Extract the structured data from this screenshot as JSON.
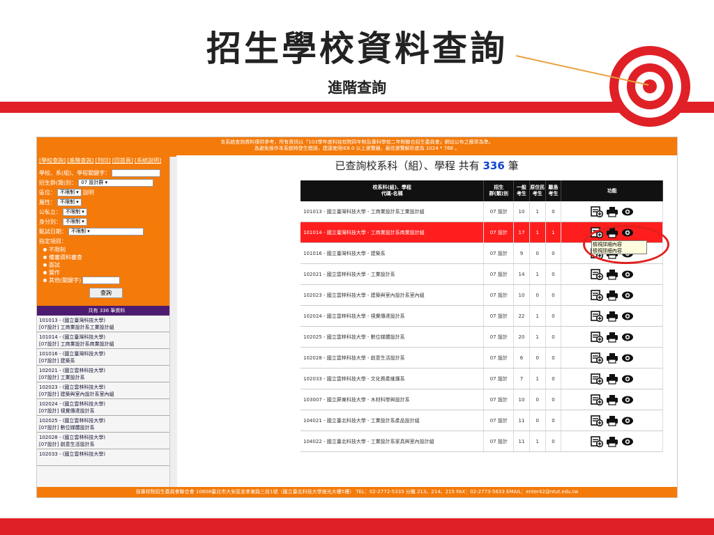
{
  "slide": {
    "title": "招生學校資料查詢",
    "subtitle": "進階查詢"
  },
  "notice": {
    "line1": "本系統查詢資料僅供參考，所有資訊以「103學年度科技校院四年制及專科學校二年制聯合招生委員會」網站公布之簡章為準。",
    "line2": "為避免操作本系統時發生錯誤，建議使用IE8.0 以上瀏覽器，最佳瀏覽解析度為 1024 * 768 。"
  },
  "sidebar": {
    "links": [
      "[學校查詢]",
      "[進階查詢]",
      "[列印]",
      "[回首頁]",
      "[系統說明]"
    ],
    "keyword_label": "學校、系(組)、學程關鍵字：",
    "group_label": "招生群(類)別：",
    "group_value": "07 設計群",
    "region_label": "區位：",
    "region_value": "不限制",
    "region_help": "說明",
    "attr_label": "屬性：",
    "attr_value": "不限制",
    "public_label": "公私立：",
    "public_value": "不限制",
    "identity_label": "身分別：",
    "identity_value": "不限制",
    "exam_date_label": "甄試日期：",
    "exam_date_value": "不限制",
    "items_label": "指定項目：",
    "options": [
      "不限制",
      "備審資料審查",
      "面試",
      "實作",
      "其他(關鍵字)"
    ],
    "search_button": "查詢",
    "count_text": "共有 336 筆資料",
    "list": [
      {
        "code": "101013 - (國立臺灣科技大學)",
        "dept": "[07設計] 工商業設計系工業設計組"
      },
      {
        "code": "101014 - (國立臺灣科技大學)",
        "dept": "[07設計] 工商業設計系商業設計組"
      },
      {
        "code": "101016 - (國立臺灣科技大學)",
        "dept": "[07設計] 建築系"
      },
      {
        "code": "102021 - (國立雲林科技大學)",
        "dept": "[07設計] 工業設計系"
      },
      {
        "code": "102023 - (國立雲林科技大學)",
        "dept": "[07設計] 建築與室內設計系室內組"
      },
      {
        "code": "102024 - (國立雲林科技大學)",
        "dept": "[07設計] 視覺傳達設計系"
      },
      {
        "code": "102025 - (國立雲林科技大學)",
        "dept": "[07設計] 數位媒體設計系"
      },
      {
        "code": "102028 - (國立雲林科技大學)",
        "dept": "[07設計] 創意生活設計系"
      },
      {
        "code": "102033 - (國立雲林科技大學)",
        "dept": ""
      }
    ]
  },
  "main": {
    "title_prefix": "已查詢校系科（組）、學程 共有",
    "count": "336",
    "title_suffix": "筆",
    "headers": {
      "name1": "校系科(組)、學程",
      "name2": "代碼-名稱",
      "group1": "招生",
      "group2": "群(類)別",
      "general1": "一般",
      "general2": "考生",
      "indigenous1": "原住民",
      "indigenous2": "考生",
      "island1": "離島",
      "island2": "考生",
      "actions": "功能"
    },
    "rows": [
      {
        "name": "101013 - 國立臺灣科技大學 - 工商業設計系工業設計組",
        "group": "07 設計",
        "general": "10",
        "indigenous": "1",
        "island": "0"
      },
      {
        "name": "101014 - 國立臺灣科技大學 - 工商業設計系商業設計組",
        "group": "07 設計",
        "general": "17",
        "indigenous": "1",
        "island": "1"
      },
      {
        "name": "101016 - 國立臺灣科技大學 - 建築系",
        "group": "07 設計",
        "general": "9",
        "indigenous": "0",
        "island": "0"
      },
      {
        "name": "102021 - 國立雲林科技大學 - 工業設計系",
        "group": "07 設計",
        "general": "14",
        "indigenous": "1",
        "island": "0"
      },
      {
        "name": "102023 - 國立雲林科技大學 - 建築與室內設計系室內組",
        "group": "07 設計",
        "general": "10",
        "indigenous": "0",
        "island": "0"
      },
      {
        "name": "102024 - 國立雲林科技大學 - 視覺傳達設計系",
        "group": "07 設計",
        "general": "22",
        "indigenous": "1",
        "island": "0"
      },
      {
        "name": "102025 - 國立雲林科技大學 - 數位媒體設計系",
        "group": "07 設計",
        "general": "20",
        "indigenous": "1",
        "island": "0"
      },
      {
        "name": "102028 - 國立雲林科技大學 - 創意生活設計系",
        "group": "07 設計",
        "general": "6",
        "indigenous": "0",
        "island": "0"
      },
      {
        "name": "102033 - 國立雲林科技大學 - 文化資產維護系",
        "group": "07 設計",
        "general": "7",
        "indigenous": "1",
        "island": "0"
      },
      {
        "name": "103007 - 國立屏東科技大學 - 木材科學與設計系",
        "group": "07 設計",
        "general": "10",
        "indigenous": "0",
        "island": "0"
      },
      {
        "name": "104021 - 國立臺北科技大學 - 工業設計系產品設計組",
        "group": "07 設計",
        "general": "11",
        "indigenous": "0",
        "island": "0"
      },
      {
        "name": "104022 - 國立臺北科技大學 - 工業設計系家具與室內設計組",
        "group": "07 設計",
        "general": "11",
        "indigenous": "1",
        "island": "0"
      }
    ],
    "tooltip": {
      "line1": "檢視詳細內容",
      "line2": "檢視詳細內容"
    }
  },
  "footer": "技專校院招生委員會聯合會 10608臺北市大安區忠孝東路三段1號（國立臺北科技大學億光大樓5樓） TEL：02-2772-5333 分機 213、214、215 FAX：02-2773-5633 EMAIL：enter42@ntut.edu.tw",
  "colors": {
    "brand_red": "#e02027",
    "orange": "#f47a0a",
    "purple": "#4d1c70",
    "link_blue": "#1144cc"
  }
}
